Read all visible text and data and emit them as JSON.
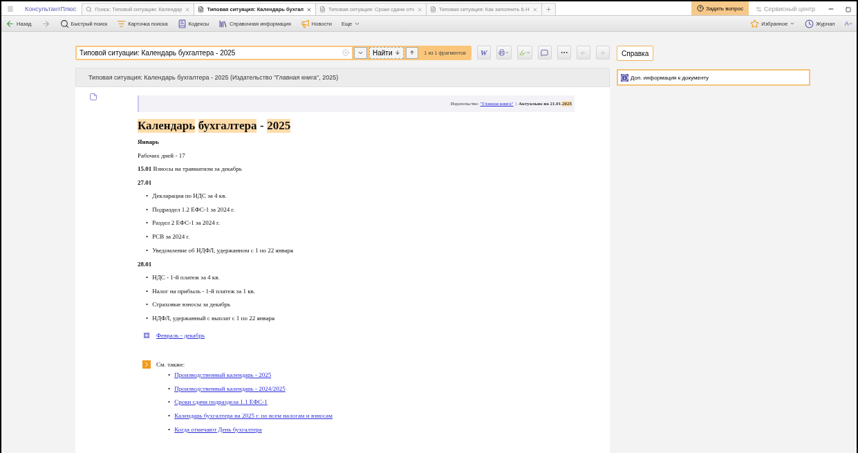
{
  "tabs_bar": {
    "logo": "КонсультантПлюс",
    "tabs": [
      {
        "kind": "search",
        "label": "Поиск: Типовой ситуации: Календар",
        "selected": false
      },
      {
        "kind": "doc",
        "label": "Типовая ситуация: Календарь бухгал",
        "selected": true
      },
      {
        "kind": "doc",
        "label": "Типовая ситуация: Сроки сдачи отч",
        "selected": false
      },
      {
        "kind": "doc",
        "label": "Типовая ситуация: Как заполнить 6-Н",
        "selected": false
      }
    ],
    "ask_button": "Задать вопрос",
    "service": "Сервисный центр"
  },
  "toolbar": {
    "items": [
      {
        "kind": "back",
        "label": "Назад",
        "disabled": false
      },
      {
        "kind": "forward",
        "disabled": true
      },
      {
        "kind": "quick",
        "label": "Быстрый поиск",
        "disabled": false
      },
      {
        "kind": "card",
        "label": "Карточка поиска",
        "disabled": false
      },
      {
        "kind": "codes",
        "label": "Кодексы",
        "disabled": false
      },
      {
        "kind": "ref",
        "label": "Справочная информация",
        "disabled": false
      },
      {
        "kind": "news",
        "label": "Новости",
        "disabled": false
      },
      {
        "kind": "more",
        "label": "Еще",
        "disabled": false
      }
    ],
    "right": [
      {
        "kind": "fav",
        "label": "Избранное"
      },
      {
        "kind": "journal",
        "label": "Журнал"
      },
      {
        "kind": "font",
        "label": "A−"
      }
    ]
  },
  "search": {
    "value": "Типовой ситуации: Календарь бухгалтера - 2025",
    "find_button": "Найти",
    "word_button": "W",
    "result": "1 из 1 фрагментов",
    "help_button": "Справка"
  },
  "document": {
    "header": "Типовая ситуация: Календарь бухгалтера - 2025 (Издательство \"Главная книга\", 2025)",
    "meta": {
      "prefix": "Издательство",
      "link": "\"Главная книга\"",
      "separator": "|",
      "date_label": "Актуально на 21.01.",
      "date_highlight": "2025"
    },
    "title_parts": [
      {
        "text": "Календарь",
        "highlighted": true
      },
      {
        "text": "бухгалтера",
        "highlighted": true
      },
      {
        "text": "-",
        "highlighted": false
      },
      {
        "text": "2025",
        "highlighted": true
      }
    ],
    "blocks": [
      {
        "kind": "heading",
        "text": "Январь"
      },
      {
        "kind": "text",
        "text": "Рабочих дней - 17"
      },
      {
        "kind": "text",
        "text": "**15.01** Взносы на травматизм за декабрь"
      },
      {
        "kind": "heading",
        "text": "27.01"
      },
      {
        "kind": "list",
        "bullet": "•",
        "items": [
          "Декларация по НДС за 4 кв.",
          "Подраздел 1.2 ЕФС-1 за 2024 г.",
          "Раздел 2 ЕФС-1 за 2024 г.",
          "РСВ за 2024 г.",
          "Уведомление об НДФЛ, удержанном с 1 по 22 января"
        ]
      },
      {
        "kind": "heading",
        "text": "28.01"
      },
      {
        "kind": "list",
        "bullet": "•",
        "items": [
          "НДС - 1-й платеж за 4 кв.",
          "Налог на прибыль - 1-й платеж за 1 кв.",
          "Страховые взносы за декабрь",
          "НДФЛ, удержанный с выплат с 1 по 22 января"
        ]
      }
    ],
    "expand_link": "Февраль - декабрь",
    "see_also": {
      "label": "См. также:",
      "bullet": "•",
      "links": [
        "Производственный календарь - 2025",
        "Производственный календарь - 2024/2025",
        "Сроки сдачи подраздела 1.1 ЕФС-1",
        "Календарь бухгалтера на 2025 г. по всем налогам и взносам",
        "Когда отмечают День бухгалтера"
      ]
    }
  },
  "side_panel": {
    "info": "Доп. информация к документу"
  }
}
